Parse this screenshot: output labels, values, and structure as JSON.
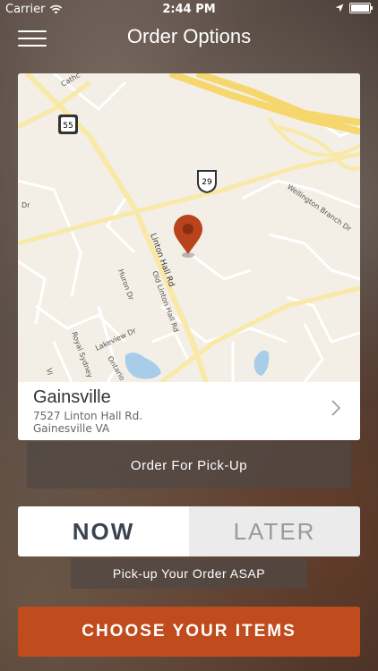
{
  "status_bar": {
    "carrier": "Carrier",
    "time": "2:44 PM"
  },
  "header": {
    "title": "Order Options"
  },
  "map": {
    "route_55": "55",
    "route_29": "29",
    "streets": [
      "Cathc",
      "Linton Hall Rd",
      "Old Linton Hall Rd",
      "Huron Dr",
      "Lakeview Dr",
      "Ontario",
      "Royal Sydney",
      "Wellington Branch Dr",
      "Dr",
      "Vi"
    ]
  },
  "location": {
    "name": "Gainsville",
    "address_line1": "7527 Linton Hall Rd.",
    "address_line2": "Gainesville VA"
  },
  "order_type": {
    "label": "Order For Pick-Up"
  },
  "timing": {
    "now_label": "NOW",
    "later_label": "LATER",
    "selected": "NOW",
    "caption": "Pick-up Your Order ASAP"
  },
  "cta": {
    "label": "CHOOSE YOUR ITEMS"
  },
  "colors": {
    "accent": "#c04b1c",
    "pin": "#b8431c",
    "map_bg": "#f3efe6",
    "highway": "#f5d76e"
  }
}
